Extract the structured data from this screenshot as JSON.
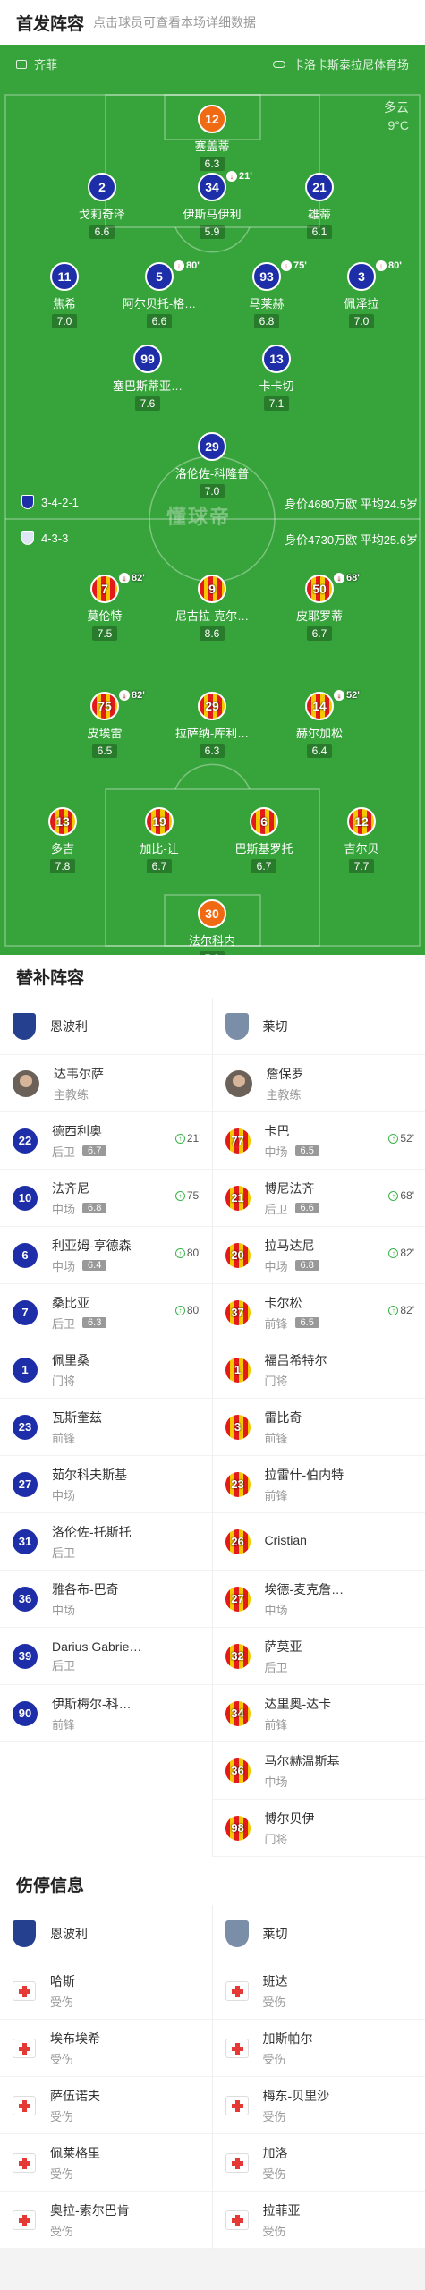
{
  "header": {
    "title": "首发阵容",
    "subtitle": "点击球员可查看本场详细数据"
  },
  "pitch": {
    "home_team": "齐菲",
    "away_team": "卡洛卡斯泰拉尼体育场",
    "weather": {
      "condition": "多云",
      "temp": "9°C"
    },
    "home_formation": "3-4-2-1",
    "home_value": "身价4680万欧 平均24.5岁",
    "away_formation": "4-3-3",
    "away_value": "身价4730万欧 平均25.6岁",
    "logo": "懂球帝",
    "home_players": [
      {
        "num": "12",
        "name": "塞盖蒂",
        "rating": "6.3",
        "kit": "orange"
      },
      {
        "num": "2",
        "name": "戈莉奇泽",
        "rating": "6.6",
        "kit": "blue"
      },
      {
        "num": "34",
        "name": "伊斯马伊利",
        "rating": "5.9",
        "kit": "blue",
        "event": "21'"
      },
      {
        "num": "21",
        "name": "雄蒂",
        "rating": "6.1",
        "kit": "blue"
      },
      {
        "num": "11",
        "name": "焦希",
        "rating": "7.0",
        "kit": "blue"
      },
      {
        "num": "5",
        "name": "阿尔贝托-格…",
        "rating": "6.6",
        "kit": "blue",
        "event": "80'"
      },
      {
        "num": "93",
        "name": "马莱赫",
        "rating": "6.8",
        "kit": "blue",
        "event": "75'"
      },
      {
        "num": "3",
        "name": "佩泽拉",
        "rating": "7.0",
        "kit": "blue",
        "event": "80'"
      },
      {
        "num": "99",
        "name": "塞巴斯蒂亚…",
        "rating": "7.6",
        "kit": "blue"
      },
      {
        "num": "13",
        "name": "卡卡切",
        "rating": "7.1",
        "kit": "blue"
      },
      {
        "num": "29",
        "name": "洛伦佐-科隆普",
        "rating": "7.0",
        "kit": "blue"
      }
    ],
    "away_players": [
      {
        "num": "7",
        "name": "莫伦特",
        "rating": "7.5",
        "kit": "stripe",
        "event": "82'"
      },
      {
        "num": "9",
        "name": "尼古拉-克尔…",
        "rating": "8.6",
        "kit": "stripe"
      },
      {
        "num": "50",
        "name": "皮耶罗蒂",
        "rating": "6.7",
        "kit": "stripe",
        "event": "68'"
      },
      {
        "num": "75",
        "name": "皮埃雷",
        "rating": "6.5",
        "kit": "stripe",
        "event": "82'"
      },
      {
        "num": "29",
        "name": "拉萨纳-库利…",
        "rating": "6.3",
        "kit": "stripe"
      },
      {
        "num": "14",
        "name": "赫尔加松",
        "rating": "6.4",
        "kit": "stripe",
        "event": "52'"
      },
      {
        "num": "13",
        "name": "多吉",
        "rating": "7.8",
        "kit": "stripe"
      },
      {
        "num": "19",
        "name": "加比-让",
        "rating": "6.7",
        "kit": "stripe"
      },
      {
        "num": "6",
        "name": "巴斯基罗托",
        "rating": "6.7",
        "kit": "stripe"
      },
      {
        "num": "12",
        "name": "吉尔贝",
        "rating": "7.7",
        "kit": "stripe"
      },
      {
        "num": "30",
        "name": "法尔科内",
        "rating": "7.2",
        "kit": "orange"
      }
    ]
  },
  "subs": {
    "title": "替补阵容",
    "home_team": "恩波利",
    "away_team": "莱切",
    "home_coach": {
      "name": "达韦尔萨",
      "role": "主教练"
    },
    "away_coach": {
      "name": "詹保罗",
      "role": "主教练"
    },
    "home": [
      {
        "num": "22",
        "name": "德西利奥",
        "pos": "后卫",
        "rating": "6.7",
        "sub": "21'"
      },
      {
        "num": "10",
        "name": "法齐尼",
        "pos": "中场",
        "rating": "6.8",
        "sub": "75'"
      },
      {
        "num": "6",
        "name": "利亚姆-亨德森",
        "pos": "中场",
        "rating": "6.4",
        "sub": "80'"
      },
      {
        "num": "7",
        "name": "桑比亚",
        "pos": "后卫",
        "rating": "6.3",
        "sub": "80'"
      },
      {
        "num": "1",
        "name": "佩里桑",
        "pos": "门将"
      },
      {
        "num": "23",
        "name": "瓦斯奎兹",
        "pos": "前锋"
      },
      {
        "num": "27",
        "name": "茹尔科夫斯基",
        "pos": "中场"
      },
      {
        "num": "31",
        "name": "洛伦佐-托斯托",
        "pos": "后卫"
      },
      {
        "num": "36",
        "name": "雅各布-巴奇",
        "pos": "中场"
      },
      {
        "num": "39",
        "name": "Darius Gabrie…",
        "pos": "后卫"
      },
      {
        "num": "90",
        "name": "伊斯梅尔-科…",
        "pos": "前锋"
      }
    ],
    "away": [
      {
        "num": "77",
        "name": "卡巴",
        "pos": "中场",
        "rating": "6.5",
        "sub": "52'"
      },
      {
        "num": "21",
        "name": "博尼法齐",
        "pos": "后卫",
        "rating": "6.6",
        "sub": "68'"
      },
      {
        "num": "20",
        "name": "拉马达尼",
        "pos": "中场",
        "rating": "6.8",
        "sub": "82'"
      },
      {
        "num": "37",
        "name": "卡尔松",
        "pos": "前锋",
        "rating": "6.5",
        "sub": "82'"
      },
      {
        "num": "1",
        "name": "福吕希特尔",
        "pos": "门将"
      },
      {
        "num": "3",
        "name": "雷比奇",
        "pos": "前锋"
      },
      {
        "num": "23",
        "name": "拉雷什-伯内特",
        "pos": "前锋"
      },
      {
        "num": "26",
        "name": "Cristian",
        "pos": ""
      },
      {
        "num": "27",
        "name": "埃德-麦克詹…",
        "pos": "中场"
      },
      {
        "num": "32",
        "name": "萨莫亚",
        "pos": "后卫"
      },
      {
        "num": "34",
        "name": "达里奥-达卡",
        "pos": "前锋"
      },
      {
        "num": "36",
        "name": "马尔赫温斯基",
        "pos": "中场"
      },
      {
        "num": "98",
        "name": "博尔贝伊",
        "pos": "门将"
      }
    ]
  },
  "injuries": {
    "title": "伤停信息",
    "home_team": "恩波利",
    "away_team": "莱切",
    "home": [
      {
        "name": "哈斯",
        "status": "受伤"
      },
      {
        "name": "埃布埃希",
        "status": "受伤"
      },
      {
        "name": "萨伍诺夫",
        "status": "受伤"
      },
      {
        "name": "佩莱格里",
        "status": "受伤"
      },
      {
        "name": "奥拉-索尔巴肯",
        "status": "受伤"
      }
    ],
    "away": [
      {
        "name": "班达",
        "status": "受伤"
      },
      {
        "name": "加斯帕尔",
        "status": "受伤"
      },
      {
        "name": "梅东-贝里沙",
        "status": "受伤"
      },
      {
        "name": "加洛",
        "status": "受伤"
      },
      {
        "name": "拉菲亚",
        "status": "受伤"
      }
    ]
  }
}
